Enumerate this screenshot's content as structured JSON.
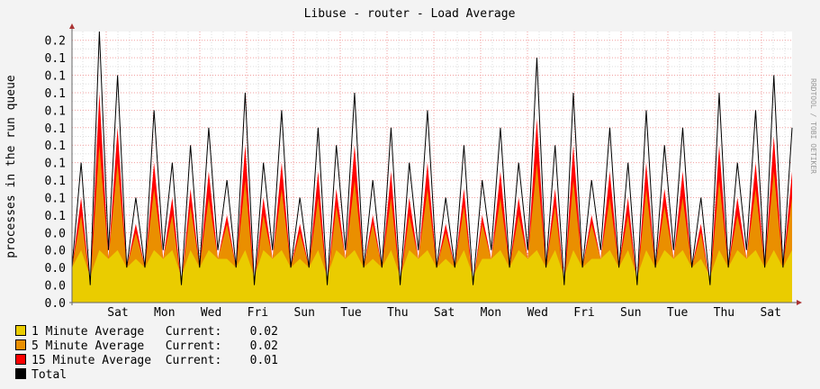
{
  "chart_data": {
    "type": "area",
    "title": "Libuse - router - Load Average",
    "ylabel": "processes in the run queue",
    "watermark": "RRDTOOL / TOBI OETIKER",
    "ylim": [
      0,
      0.155
    ],
    "yticks": [
      0.0,
      0.01,
      0.02,
      0.03,
      0.04,
      0.05,
      0.06,
      0.07,
      0.08,
      0.09,
      0.1,
      0.11,
      0.12,
      0.13,
      0.14,
      0.15
    ],
    "ytick_labels": [
      "0.0",
      "0.0",
      "0.0",
      "0.0",
      "0.0",
      "0.1",
      "0.1",
      "0.1",
      "0.1",
      "0.1",
      "0.1",
      "0.1",
      "0.1",
      "0.1",
      "0.1",
      "0.2"
    ],
    "xtick_labels": [
      "Sat",
      "Mon",
      "Wed",
      "Fri",
      "Sun",
      "Tue",
      "Thu",
      "Sat",
      "Mon",
      "Wed",
      "Fri",
      "Sun",
      "Tue",
      "Thu",
      "Sat"
    ],
    "grid": true,
    "series": [
      {
        "name": "1 Minute Average",
        "color": "#eacc00",
        "current": "0.02",
        "values": [
          0.02,
          0.03,
          0.015,
          0.03,
          0.025,
          0.03,
          0.02,
          0.025,
          0.02,
          0.03,
          0.025,
          0.03,
          0.015,
          0.03,
          0.02,
          0.03,
          0.025,
          0.025,
          0.02,
          0.03,
          0.015,
          0.03,
          0.025,
          0.03,
          0.02,
          0.025,
          0.02,
          0.03,
          0.015,
          0.03,
          0.025,
          0.03,
          0.02,
          0.025,
          0.02,
          0.03,
          0.015,
          0.03,
          0.025,
          0.03,
          0.02,
          0.025,
          0.02,
          0.03,
          0.015,
          0.025,
          0.025,
          0.03,
          0.02,
          0.03,
          0.025,
          0.03,
          0.02,
          0.03,
          0.015,
          0.03,
          0.02,
          0.025,
          0.025,
          0.03,
          0.02,
          0.03,
          0.015,
          0.03,
          0.02,
          0.03,
          0.025,
          0.03,
          0.02,
          0.025,
          0.015,
          0.03,
          0.02,
          0.03,
          0.025,
          0.03,
          0.02,
          0.03,
          0.02,
          0.03
        ]
      },
      {
        "name": "5 Minute Average",
        "color": "#ea8f00",
        "current": "0.02",
        "values": [
          0.02,
          0.05,
          0.01,
          0.09,
          0.025,
          0.08,
          0.02,
          0.04,
          0.02,
          0.065,
          0.025,
          0.05,
          0.01,
          0.055,
          0.02,
          0.06,
          0.025,
          0.045,
          0.02,
          0.07,
          0.01,
          0.05,
          0.025,
          0.065,
          0.02,
          0.04,
          0.02,
          0.06,
          0.01,
          0.055,
          0.025,
          0.07,
          0.02,
          0.045,
          0.02,
          0.06,
          0.01,
          0.05,
          0.025,
          0.065,
          0.02,
          0.04,
          0.02,
          0.055,
          0.01,
          0.045,
          0.025,
          0.06,
          0.02,
          0.05,
          0.025,
          0.08,
          0.02,
          0.055,
          0.01,
          0.07,
          0.02,
          0.045,
          0.025,
          0.06,
          0.02,
          0.05,
          0.01,
          0.065,
          0.02,
          0.055,
          0.025,
          0.06,
          0.02,
          0.04,
          0.01,
          0.07,
          0.02,
          0.05,
          0.025,
          0.065,
          0.02,
          0.075,
          0.02,
          0.06
        ]
      },
      {
        "name": "15 Minute Average",
        "color": "#ff0000",
        "current": "0.01",
        "values": [
          0.02,
          0.06,
          0.01,
          0.12,
          0.025,
          0.1,
          0.02,
          0.045,
          0.02,
          0.08,
          0.025,
          0.06,
          0.01,
          0.065,
          0.02,
          0.075,
          0.025,
          0.05,
          0.02,
          0.09,
          0.01,
          0.06,
          0.025,
          0.08,
          0.02,
          0.045,
          0.02,
          0.075,
          0.01,
          0.065,
          0.025,
          0.09,
          0.02,
          0.05,
          0.02,
          0.075,
          0.01,
          0.06,
          0.025,
          0.08,
          0.02,
          0.045,
          0.02,
          0.065,
          0.01,
          0.05,
          0.025,
          0.075,
          0.02,
          0.06,
          0.025,
          0.105,
          0.02,
          0.065,
          0.01,
          0.09,
          0.02,
          0.05,
          0.025,
          0.075,
          0.02,
          0.06,
          0.01,
          0.08,
          0.02,
          0.065,
          0.025,
          0.075,
          0.02,
          0.045,
          0.01,
          0.09,
          0.02,
          0.06,
          0.025,
          0.08,
          0.02,
          0.095,
          0.02,
          0.075
        ]
      },
      {
        "name": "Total",
        "color": "#000000",
        "current": "",
        "values": [
          0.02,
          0.08,
          0.01,
          0.155,
          0.03,
          0.13,
          0.02,
          0.06,
          0.02,
          0.11,
          0.03,
          0.08,
          0.01,
          0.09,
          0.02,
          0.1,
          0.03,
          0.07,
          0.02,
          0.12,
          0.01,
          0.08,
          0.03,
          0.11,
          0.02,
          0.06,
          0.02,
          0.1,
          0.01,
          0.09,
          0.03,
          0.12,
          0.02,
          0.07,
          0.02,
          0.1,
          0.01,
          0.08,
          0.03,
          0.11,
          0.02,
          0.06,
          0.02,
          0.09,
          0.01,
          0.07,
          0.03,
          0.1,
          0.02,
          0.08,
          0.03,
          0.14,
          0.02,
          0.09,
          0.01,
          0.12,
          0.02,
          0.07,
          0.03,
          0.1,
          0.02,
          0.08,
          0.01,
          0.11,
          0.02,
          0.09,
          0.03,
          0.1,
          0.02,
          0.06,
          0.01,
          0.12,
          0.02,
          0.08,
          0.03,
          0.11,
          0.02,
          0.13,
          0.02,
          0.1
        ]
      }
    ]
  },
  "legend": {
    "current_label": "Current:"
  }
}
